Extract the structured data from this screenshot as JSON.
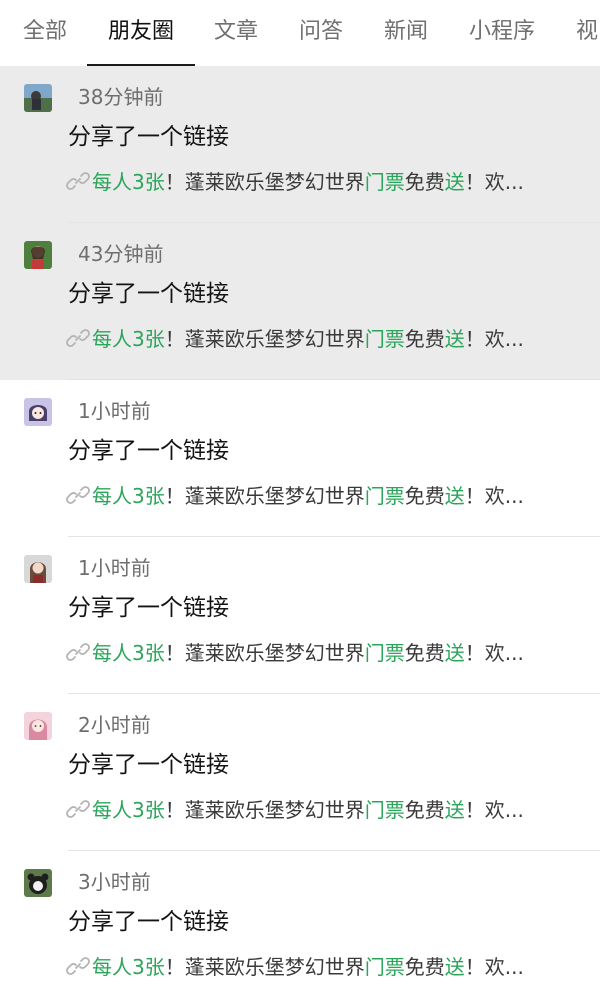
{
  "tabs": [
    {
      "label": "全部",
      "active": false
    },
    {
      "label": "朋友圈",
      "active": true
    },
    {
      "label": "文章",
      "active": false
    },
    {
      "label": "问答",
      "active": false
    },
    {
      "label": "新闻",
      "active": false
    },
    {
      "label": "小程序",
      "active": false
    },
    {
      "label": "视",
      "active": false
    }
  ],
  "feed": {
    "items": [
      {
        "time": "38分钟前",
        "title": "分享了一个链接",
        "link": {
          "p1": "每人3张",
          "p2": "！蓬莱欧乐堡梦幻世界",
          "p3": "门票",
          "p4": "免费",
          "p5": "送",
          "p6": "！欢..."
        },
        "read": true
      },
      {
        "time": "43分钟前",
        "title": "分享了一个链接",
        "link": {
          "p1": "每人3张",
          "p2": "！蓬莱欧乐堡梦幻世界",
          "p3": "门票",
          "p4": "免费",
          "p5": "送",
          "p6": "！欢..."
        },
        "read": true
      },
      {
        "time": "1小时前",
        "title": "分享了一个链接",
        "link": {
          "p1": "每人3张",
          "p2": "！蓬莱欧乐堡梦幻世界",
          "p3": "门票",
          "p4": "免费",
          "p5": "送",
          "p6": "！欢..."
        },
        "read": false
      },
      {
        "time": "1小时前",
        "title": "分享了一个链接",
        "link": {
          "p1": "每人3张",
          "p2": "！蓬莱欧乐堡梦幻世界",
          "p3": "门票",
          "p4": "免费",
          "p5": "送",
          "p6": "！欢..."
        },
        "read": false
      },
      {
        "time": "2小时前",
        "title": "分享了一个链接",
        "link": {
          "p1": "每人3张",
          "p2": "！蓬莱欧乐堡梦幻世界",
          "p3": "门票",
          "p4": "免费",
          "p5": "送",
          "p6": "！欢..."
        },
        "read": false
      },
      {
        "time": "3小时前",
        "title": "分享了一个链接",
        "link": {
          "p1": "每人3张",
          "p2": "！蓬莱欧乐堡梦幻世界",
          "p3": "门票",
          "p4": "免费",
          "p5": "送",
          "p6": "！欢..."
        },
        "read": false
      }
    ]
  },
  "colors": {
    "highlight": "#2aa55a",
    "read_background": "#ebebeb",
    "tab_active": "#111111",
    "tab_inactive": "#707070"
  }
}
